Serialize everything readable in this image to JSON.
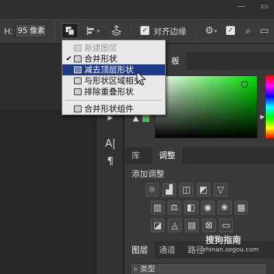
{
  "titlebar": {
    "minimize": "—",
    "restore": "▭"
  },
  "options_bar": {
    "height_label": "H:",
    "height_value": "95 像素",
    "align_edges_label": "对齐边缘"
  },
  "tools_side": {
    "type_tool": "A|",
    "para_tool": "¶"
  },
  "color_panel": {
    "tab_label": "板"
  },
  "adjust_panel": {
    "tabs": [
      "库",
      "调整"
    ],
    "title": "添加调整"
  },
  "layers_panel": {
    "tabs": [
      "图层",
      "通道",
      "路径"
    ],
    "search_value": "类型"
  },
  "menu": {
    "items": [
      {
        "label": "新建图层",
        "checked": false,
        "disabled": true
      },
      {
        "label": "合并形状",
        "checked": true,
        "disabled": false
      },
      {
        "label": "减去顶层形状",
        "checked": false,
        "disabled": false,
        "highlighted": true
      },
      {
        "label": "与形状区域相交",
        "checked": false,
        "disabled": false
      },
      {
        "label": "排除重叠形状",
        "checked": false,
        "disabled": false
      }
    ],
    "footer_item": "合并形状组件"
  },
  "watermark": {
    "text": "搜狗指南",
    "url": "zhinan.sogou.com"
  },
  "colors": {
    "highlight": "#1e3a8a",
    "picker_hue": "#00e000",
    "menu_bg": "#e9e9e9"
  }
}
